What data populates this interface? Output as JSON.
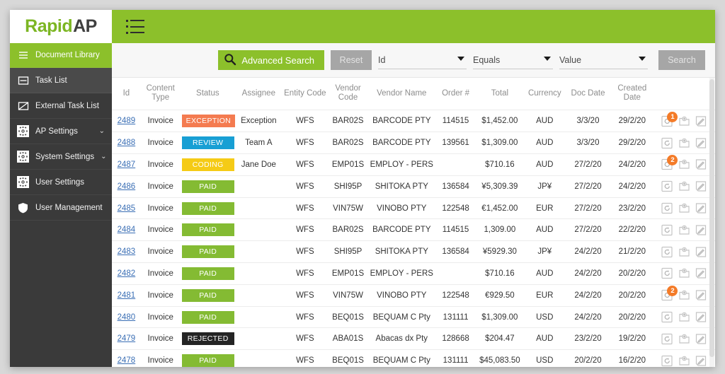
{
  "brand": {
    "logo_rapid": "Rapid",
    "logo_ap": "AP",
    "green": "#8cc02b",
    "dark": "#3f3f3f"
  },
  "topbar": {
    "menu_icon": "hamburger-list-icon"
  },
  "sidebar": {
    "items": [
      {
        "label": "Document Library",
        "icon": "list-lines-icon",
        "state": "active",
        "chevron": ""
      },
      {
        "label": "Task List",
        "icon": "task-box-icon",
        "state": "second",
        "chevron": ""
      },
      {
        "label": "External Task List",
        "icon": "external-box-icon",
        "state": "normal",
        "chevron": ""
      },
      {
        "label": "AP Settings",
        "icon": "gear-icon",
        "state": "normal",
        "chevron": "⌄"
      },
      {
        "label": "System Settings",
        "icon": "gear-icon",
        "state": "normal",
        "chevron": "⌄"
      },
      {
        "label": "User Settings",
        "icon": "gear-icon",
        "state": "normal",
        "chevron": ""
      },
      {
        "label": "User Management",
        "icon": "shield-icon",
        "state": "normal",
        "chevron": ""
      }
    ]
  },
  "search": {
    "advanced_label": "Advanced Search",
    "advanced_icon": "search-icon",
    "reset_label": "Reset",
    "search_label": "Search",
    "field_select": "Id",
    "operator_select": "Equals",
    "value_select": "Value"
  },
  "table": {
    "columns": [
      "Id",
      "Content Type",
      "Status",
      "Assignee",
      "Entity Code",
      "Vendor Code",
      "Vendor Name",
      "Order #",
      "Total",
      "Currency",
      "Doc Date",
      "Created Date",
      ""
    ],
    "action_icons": [
      "refresh-history-icon",
      "add-folder-icon",
      "edit-pencil-icon"
    ],
    "rows": [
      {
        "id": "2489",
        "type": "Invoice",
        "status": "EXCEPTION",
        "status_class": "b-exception",
        "assignee": "Exception",
        "entity": "WFS",
        "vcode": "BAR02S",
        "vname": "BARCODE PTY",
        "order": "114515",
        "total": "$1,452.00",
        "currency": "AUD",
        "doc_date": "3/3/20",
        "created_date": "29/2/20",
        "badge": "1"
      },
      {
        "id": "2488",
        "type": "Invoice",
        "status": "REVIEW",
        "status_class": "b-review",
        "assignee": "Team A",
        "entity": "WFS",
        "vcode": "BAR02S",
        "vname": "BARCODE PTY",
        "order": "139561",
        "total": "$1,309.00",
        "currency": "AUD",
        "doc_date": "3/3/20",
        "created_date": "29/2/20",
        "badge": ""
      },
      {
        "id": "2487",
        "type": "Invoice",
        "status": "CODING",
        "status_class": "b-coding",
        "assignee": "Jane Doe",
        "entity": "WFS",
        "vcode": "EMP01S",
        "vname": "EMPLOY - PERS",
        "order": "",
        "total": "$710.16",
        "currency": "AUD",
        "doc_date": "27/2/20",
        "created_date": "24/2/20",
        "badge": "2"
      },
      {
        "id": "2486",
        "type": "Invoice",
        "status": "PAID",
        "status_class": "b-paid",
        "assignee": "",
        "entity": "WFS",
        "vcode": "SHI95P",
        "vname": "SHITOKA PTY",
        "order": "136584",
        "total": "¥5,309.39",
        "currency": "JP¥",
        "doc_date": "27/2/20",
        "created_date": "24/2/20",
        "badge": ""
      },
      {
        "id": "2485",
        "type": "Invoice",
        "status": "PAID",
        "status_class": "b-paid",
        "assignee": "",
        "entity": "WFS",
        "vcode": "VIN75W",
        "vname": "VINOBO PTY",
        "order": "122548",
        "total": "€1,452.00",
        "currency": "EUR",
        "doc_date": "27/2/20",
        "created_date": "23/2/20",
        "badge": ""
      },
      {
        "id": "2484",
        "type": "Invoice",
        "status": "PAID",
        "status_class": "b-paid",
        "assignee": "",
        "entity": "WFS",
        "vcode": "BAR02S",
        "vname": "BARCODE PTY",
        "order": "114515",
        "total": "1,309.00",
        "currency": "AUD",
        "doc_date": "27/2/20",
        "created_date": "22/2/20",
        "badge": ""
      },
      {
        "id": "2483",
        "type": "Invoice",
        "status": "PAID",
        "status_class": "b-paid",
        "assignee": "",
        "entity": "WFS",
        "vcode": "SHI95P",
        "vname": "SHITOKA PTY",
        "order": "136584",
        "total": "¥5929.30",
        "currency": "JP¥",
        "doc_date": "24/2/20",
        "created_date": "21/2/20",
        "badge": ""
      },
      {
        "id": "2482",
        "type": "Invoice",
        "status": "PAID",
        "status_class": "b-paid",
        "assignee": "",
        "entity": "WFS",
        "vcode": "EMP01S",
        "vname": "EMPLOY - PERS",
        "order": "",
        "total": "$710.16",
        "currency": "AUD",
        "doc_date": "24/2/20",
        "created_date": "20/2/20",
        "badge": ""
      },
      {
        "id": "2481",
        "type": "Invoice",
        "status": "PAID",
        "status_class": "b-paid",
        "assignee": "",
        "entity": "WFS",
        "vcode": "VIN75W",
        "vname": "VINOBO PTY",
        "order": "122548",
        "total": "€929.50",
        "currency": "EUR",
        "doc_date": "24/2/20",
        "created_date": "20/2/20",
        "badge": "2"
      },
      {
        "id": "2480",
        "type": "Invoice",
        "status": "PAID",
        "status_class": "b-paid",
        "assignee": "",
        "entity": "WFS",
        "vcode": "BEQ01S",
        "vname": "BEQUAM C Pty",
        "order": "131111",
        "total": "$1,309.00",
        "currency": "USD",
        "doc_date": "24/2/20",
        "created_date": "20/2/20",
        "badge": ""
      },
      {
        "id": "2479",
        "type": "Invoice",
        "status": "REJECTED",
        "status_class": "b-rejected",
        "assignee": "",
        "entity": "WFS",
        "vcode": "ABA01S",
        "vname": "Abacas dx Pty",
        "order": "128668",
        "total": "$204.47",
        "currency": "AUD",
        "doc_date": "23/2/20",
        "created_date": "19/2/20",
        "badge": ""
      },
      {
        "id": "2478",
        "type": "Invoice",
        "status": "PAID",
        "status_class": "b-paid",
        "assignee": "",
        "entity": "WFS",
        "vcode": "BEQ01S",
        "vname": "BEQUAM C Pty",
        "order": "131111",
        "total": "$45,083.50",
        "currency": "USD",
        "doc_date": "20/2/20",
        "created_date": "16/2/20",
        "badge": ""
      }
    ]
  }
}
